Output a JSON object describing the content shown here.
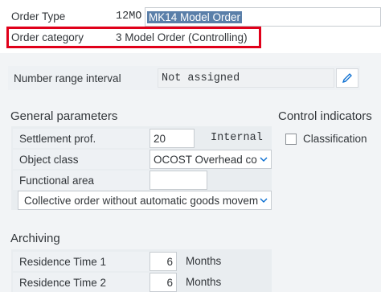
{
  "header": {
    "order_type_label": "Order Type",
    "order_type_code": "12MO",
    "order_type_desc": "MK14 Model Order",
    "order_category_label": "Order category",
    "order_category_value": "3 Model Order (Controlling)"
  },
  "number_range": {
    "label": "Number range interval",
    "value": "Not assigned",
    "edit_icon": "pencil-icon"
  },
  "general_parameters": {
    "title": "General parameters",
    "settlement_label": "Settlement prof.",
    "settlement_value": "20",
    "settlement_desc": "Internal",
    "object_class_label": "Object class",
    "object_class_value": "OCOST Overhead co",
    "functional_area_label": "Functional area",
    "functional_area_value": "",
    "goods_movement_value": "Collective order without automatic goods movem"
  },
  "control_indicators": {
    "title": "Control indicators",
    "classification_label": "Classification",
    "classification_checked": false
  },
  "archiving": {
    "title": "Archiving",
    "residence1_label": "Residence Time 1",
    "residence1_value": "6",
    "residence1_unit": "Months",
    "residence2_label": "Residence Time 2",
    "residence2_value": "6",
    "residence2_unit": "Months"
  },
  "colors": {
    "highlight": "#e0001a",
    "selection": "#5a7fa9"
  }
}
